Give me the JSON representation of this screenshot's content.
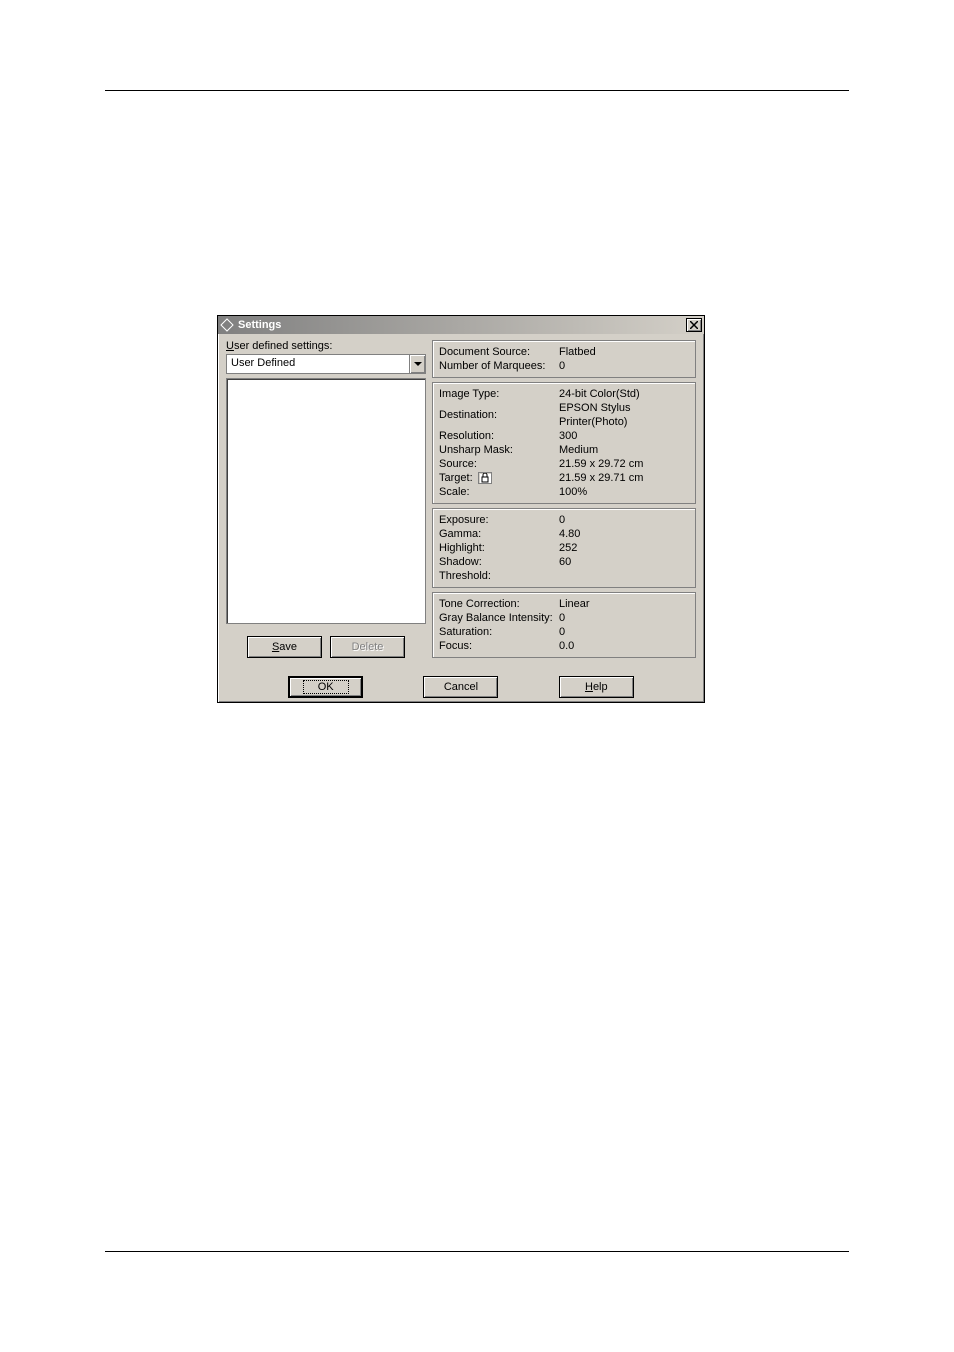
{
  "titlebar": {
    "title": "Settings"
  },
  "left": {
    "user_defined_label_prefix": "U",
    "user_defined_label_rest": "ser defined settings:",
    "combo_value": "User Defined",
    "save_prefix": "S",
    "save_rest": "ave",
    "delete_label": "Delete"
  },
  "group1": {
    "document_source_label": "Document Source:",
    "document_source_value": "Flatbed",
    "num_marquees_label": "Number of Marquees:",
    "num_marquees_value": "0"
  },
  "group2": {
    "image_type_label": "Image Type:",
    "image_type_value": "24-bit Color(Std)",
    "destination_label": "Destination:",
    "destination_value": "EPSON Stylus Printer(Photo)",
    "resolution_label": "Resolution:",
    "resolution_value": "300",
    "unsharp_mask_label": "Unsharp Mask:",
    "unsharp_mask_value": "Medium",
    "source_label": "Source:",
    "source_value": "21.59 x 29.72 cm",
    "target_label": "Target:",
    "target_value": "21.59 x 29.71 cm",
    "scale_label": "Scale:",
    "scale_value": "100%"
  },
  "group3": {
    "exposure_label": "Exposure:",
    "exposure_value": "0",
    "gamma_label": "Gamma:",
    "gamma_value": "4.80",
    "highlight_label": "Highlight:",
    "highlight_value": "252",
    "shadow_label": "Shadow:",
    "shadow_value": "60",
    "threshold_label": "Threshold:",
    "threshold_value": ""
  },
  "group4": {
    "tone_correction_label": "Tone Correction:",
    "tone_correction_value": "Linear",
    "gray_balance_label": "Gray Balance Intensity:",
    "gray_balance_value": "0",
    "saturation_label": "Saturation:",
    "saturation_value": "0",
    "focus_label": "Focus:",
    "focus_value": "0.0"
  },
  "buttons": {
    "ok": "OK",
    "cancel": "Cancel",
    "help_prefix": "H",
    "help_rest": "elp"
  }
}
